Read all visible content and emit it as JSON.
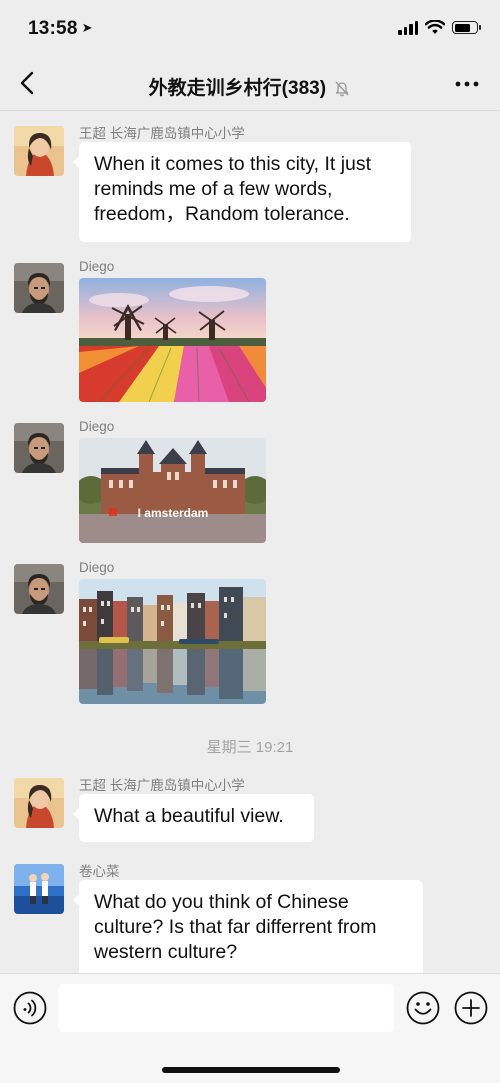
{
  "status_bar": {
    "time": "13:58"
  },
  "header": {
    "title": "外教走训乡村行(383)"
  },
  "messages": [
    {
      "sender": "王超 长海广鹿岛镇中心小学",
      "text": "When it comes to this city, It just reminds me of a few words, freedom，Random tolerance."
    },
    {
      "sender": "Diego",
      "image": "tulip-field-with-windmills"
    },
    {
      "sender": "Diego",
      "image": "rijksmuseum-iamsterdam"
    },
    {
      "sender": "Diego",
      "image": "amsterdam-canal-houses"
    },
    {
      "timestamp": "星期三 19:21"
    },
    {
      "sender": "王超 长海广鹿岛镇中心小学",
      "text": "What a beautiful view."
    },
    {
      "sender": "卷心菜",
      "text": "What do you think of Chinese culture?  Is that far differrent from western culture?"
    }
  ],
  "photo_overlay_text": "I amsterdam",
  "input": {
    "value": "",
    "placeholder": ""
  },
  "colors": {
    "background": "#ededed",
    "bubble": "#ffffff",
    "sender_text": "#7f7f7f",
    "timestamp_text": "#a3a3a3"
  }
}
